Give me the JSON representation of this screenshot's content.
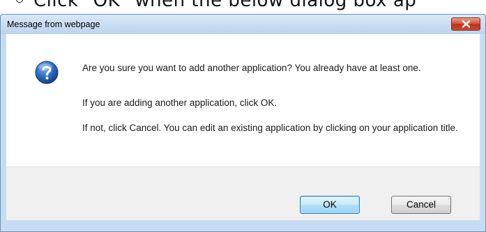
{
  "background": {
    "instruction_text": "Click \"OK\" when the below dialog box ap"
  },
  "dialog": {
    "title": "Message from webpage",
    "close_icon": "close-icon",
    "question_icon": "question-icon",
    "messages": [
      "Are you sure you want to add another application? You already have at least one.",
      "If you are adding another application, click OK.",
      "If not, click Cancel. You can edit an existing application by clicking on your application title."
    ],
    "buttons": {
      "ok_label": "OK",
      "cancel_label": "Cancel"
    },
    "colors": {
      "frame": "#c7dcf2",
      "close_button": "#c8452b",
      "ok_button_focus": "#3c7fb1",
      "question_icon": "#1f5aa8"
    }
  }
}
